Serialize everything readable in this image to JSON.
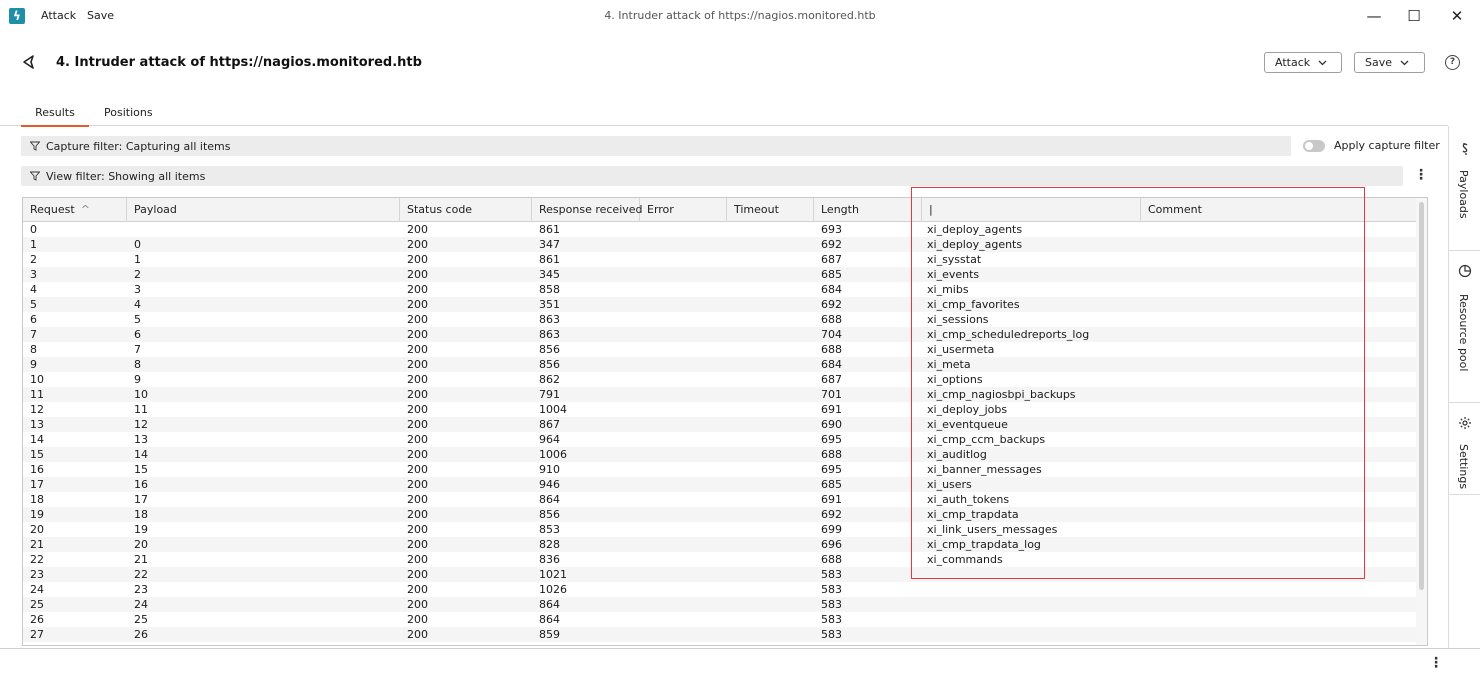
{
  "titlebar": {
    "menu": [
      "Attack",
      "Save"
    ],
    "window_title": "4. Intruder attack of https://nagios.monitored.htb",
    "minimize": "—",
    "maximize": "☐",
    "close": "✕"
  },
  "header": {
    "title": "4. Intruder attack of https://nagios.monitored.htb",
    "attack_button": "Attack",
    "save_button": "Save",
    "help": "?"
  },
  "tabs": [
    "Results",
    "Positions"
  ],
  "active_tab": "Results",
  "filters": {
    "capture": "Capture filter: Capturing all items",
    "view": "View filter: Showing all items",
    "apply_capture_label": "Apply capture filter",
    "apply_capture_on": false
  },
  "table": {
    "columns": [
      "Request",
      "Payload",
      "Status code",
      "Response received",
      "Error",
      "Timeout",
      "Length",
      "|",
      "Comment"
    ],
    "sort_indicator": "^",
    "rows": [
      [
        "0",
        "",
        "200",
        "861",
        "",
        "",
        "693",
        "xi_deploy_agents",
        ""
      ],
      [
        "1",
        "0",
        "200",
        "347",
        "",
        "",
        "692",
        "xi_deploy_agents",
        ""
      ],
      [
        "2",
        "1",
        "200",
        "861",
        "",
        "",
        "687",
        "xi_sysstat",
        ""
      ],
      [
        "3",
        "2",
        "200",
        "345",
        "",
        "",
        "685",
        "xi_events",
        ""
      ],
      [
        "4",
        "3",
        "200",
        "858",
        "",
        "",
        "684",
        "xi_mibs",
        ""
      ],
      [
        "5",
        "4",
        "200",
        "351",
        "",
        "",
        "692",
        "xi_cmp_favorites",
        ""
      ],
      [
        "6",
        "5",
        "200",
        "863",
        "",
        "",
        "688",
        "xi_sessions",
        ""
      ],
      [
        "7",
        "6",
        "200",
        "863",
        "",
        "",
        "704",
        "xi_cmp_scheduledreports_log",
        ""
      ],
      [
        "8",
        "7",
        "200",
        "856",
        "",
        "",
        "688",
        "xi_usermeta",
        ""
      ],
      [
        "9",
        "8",
        "200",
        "856",
        "",
        "",
        "684",
        "xi_meta",
        ""
      ],
      [
        "10",
        "9",
        "200",
        "862",
        "",
        "",
        "687",
        "xi_options",
        ""
      ],
      [
        "11",
        "10",
        "200",
        "791",
        "",
        "",
        "701",
        "xi_cmp_nagiosbpi_backups",
        ""
      ],
      [
        "12",
        "11",
        "200",
        "1004",
        "",
        "",
        "691",
        "xi_deploy_jobs",
        ""
      ],
      [
        "13",
        "12",
        "200",
        "867",
        "",
        "",
        "690",
        "xi_eventqueue",
        ""
      ],
      [
        "14",
        "13",
        "200",
        "964",
        "",
        "",
        "695",
        "xi_cmp_ccm_backups",
        ""
      ],
      [
        "15",
        "14",
        "200",
        "1006",
        "",
        "",
        "688",
        "xi_auditlog",
        ""
      ],
      [
        "16",
        "15",
        "200",
        "910",
        "",
        "",
        "695",
        "xi_banner_messages",
        ""
      ],
      [
        "17",
        "16",
        "200",
        "946",
        "",
        "",
        "685",
        "xi_users",
        ""
      ],
      [
        "18",
        "17",
        "200",
        "864",
        "",
        "",
        "691",
        "xi_auth_tokens",
        ""
      ],
      [
        "19",
        "18",
        "200",
        "856",
        "",
        "",
        "692",
        "xi_cmp_trapdata",
        ""
      ],
      [
        "20",
        "19",
        "200",
        "853",
        "",
        "",
        "699",
        "xi_link_users_messages",
        ""
      ],
      [
        "21",
        "20",
        "200",
        "828",
        "",
        "",
        "696",
        "xi_cmp_trapdata_log",
        ""
      ],
      [
        "22",
        "21",
        "200",
        "836",
        "",
        "",
        "688",
        "xi_commands",
        ""
      ],
      [
        "23",
        "22",
        "200",
        "1021",
        "",
        "",
        "583",
        "",
        ""
      ],
      [
        "24",
        "23",
        "200",
        "1026",
        "",
        "",
        "583",
        "",
        ""
      ],
      [
        "25",
        "24",
        "200",
        "864",
        "",
        "",
        "583",
        "",
        ""
      ],
      [
        "26",
        "25",
        "200",
        "864",
        "",
        "",
        "583",
        "",
        ""
      ],
      [
        "27",
        "26",
        "200",
        "859",
        "",
        "",
        "583",
        "",
        ""
      ]
    ]
  },
  "sidebar": {
    "items": [
      "Payloads",
      "Resource pool",
      "Settings"
    ]
  },
  "colors": {
    "accent": "#e55b25",
    "highlight": "#e23a3a",
    "logo": "#1e8fa6"
  }
}
